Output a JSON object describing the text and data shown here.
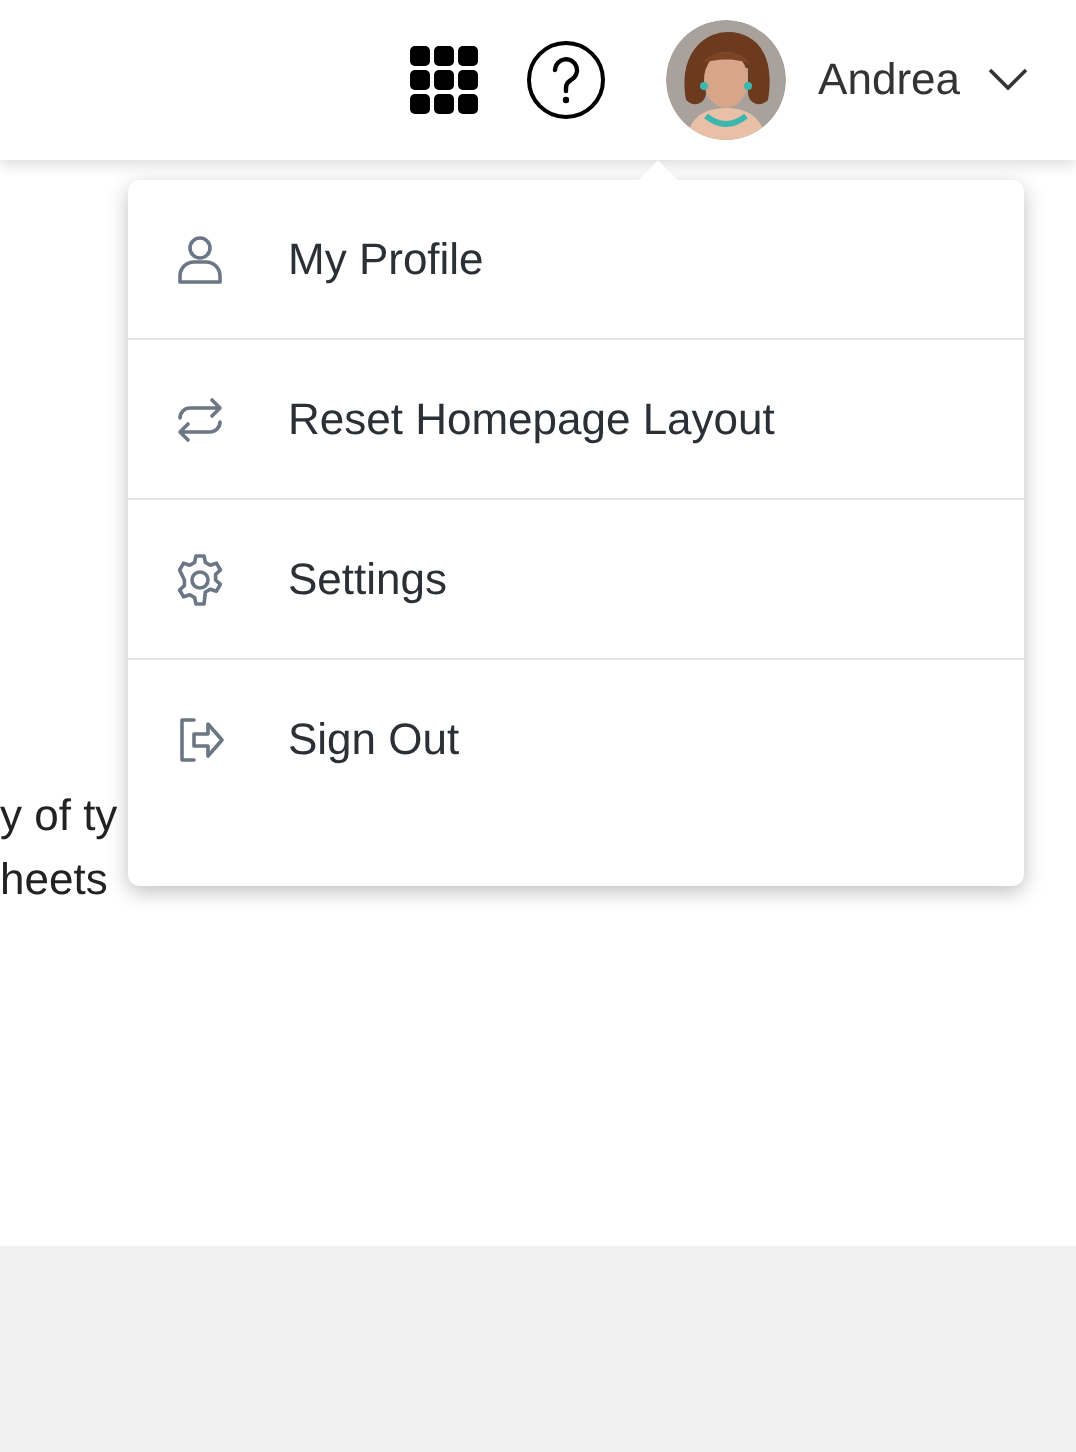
{
  "header": {
    "user_name": "Andrea"
  },
  "background_text": [
    "y of ty",
    "heets"
  ],
  "menu": {
    "items": [
      {
        "label": "My Profile",
        "kind": "profile"
      },
      {
        "label": "Reset Homepage Layout",
        "kind": "reset"
      },
      {
        "label": "Settings",
        "kind": "settings"
      },
      {
        "label": "Sign Out",
        "kind": "signout"
      }
    ]
  }
}
